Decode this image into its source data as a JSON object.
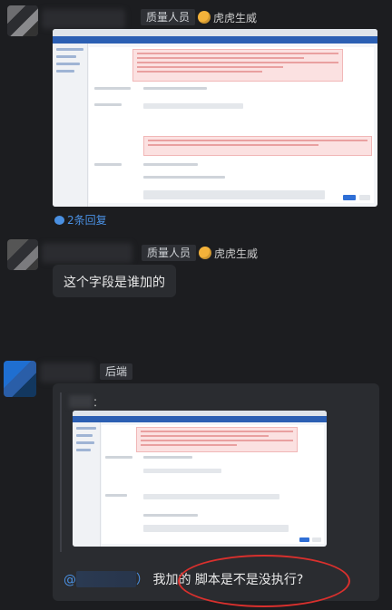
{
  "messages": [
    {
      "role_tag": "质量人员",
      "sender_name": "虎虎生威",
      "has_screenshot": true,
      "reply_count_label": "2条回复"
    },
    {
      "role_tag": "质量人员",
      "sender_name": "虎虎生威",
      "text": "这个字段是谁加的"
    },
    {
      "role_tag": "后端",
      "quoted_prefix": "：",
      "mention_at": "@",
      "mention_suffix": "）",
      "reply_text": "我加的  脚本是不是没执行?"
    }
  ],
  "colors": {
    "background": "#1c1d20",
    "bubble": "#2a2c30",
    "link": "#4a90e2",
    "annotation_red": "#d9302d"
  },
  "icons": {
    "emoji": "face-emoji-icon",
    "reply": "reply-bubble-icon"
  }
}
